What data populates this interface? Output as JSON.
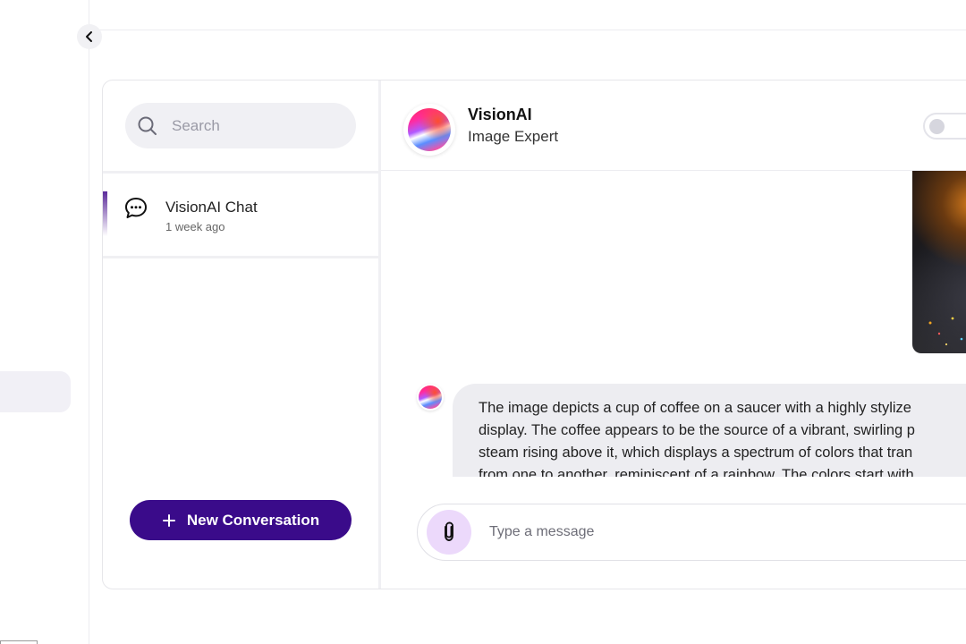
{
  "search": {
    "placeholder": "Search"
  },
  "conversations": [
    {
      "title": "VisionAI Chat",
      "time": "1 week ago"
    }
  ],
  "new_conversation_label": "New Conversation",
  "chat": {
    "agent_name": "VisionAI",
    "agent_role": "Image Expert",
    "message_lines": [
      "The image depicts a cup of coffee on a saucer with a highly stylize",
      "display. The coffee appears to be the source of a vibrant, swirling p",
      "steam rising above it, which displays a spectrum of colors that tran",
      "from one to another, reminiscent of a rainbow. The colors start with"
    ],
    "composer_placeholder": "Type a message"
  },
  "colors": {
    "primary_button": "#3a0b8a",
    "attach_button": "#ecd9fb",
    "bubble": "#ededf1"
  },
  "icons": {
    "collapse": "chevron-left-icon",
    "search": "search-icon",
    "conversation": "chat-bubble-icon",
    "new": "plus-icon",
    "attach": "paperclip-icon"
  }
}
